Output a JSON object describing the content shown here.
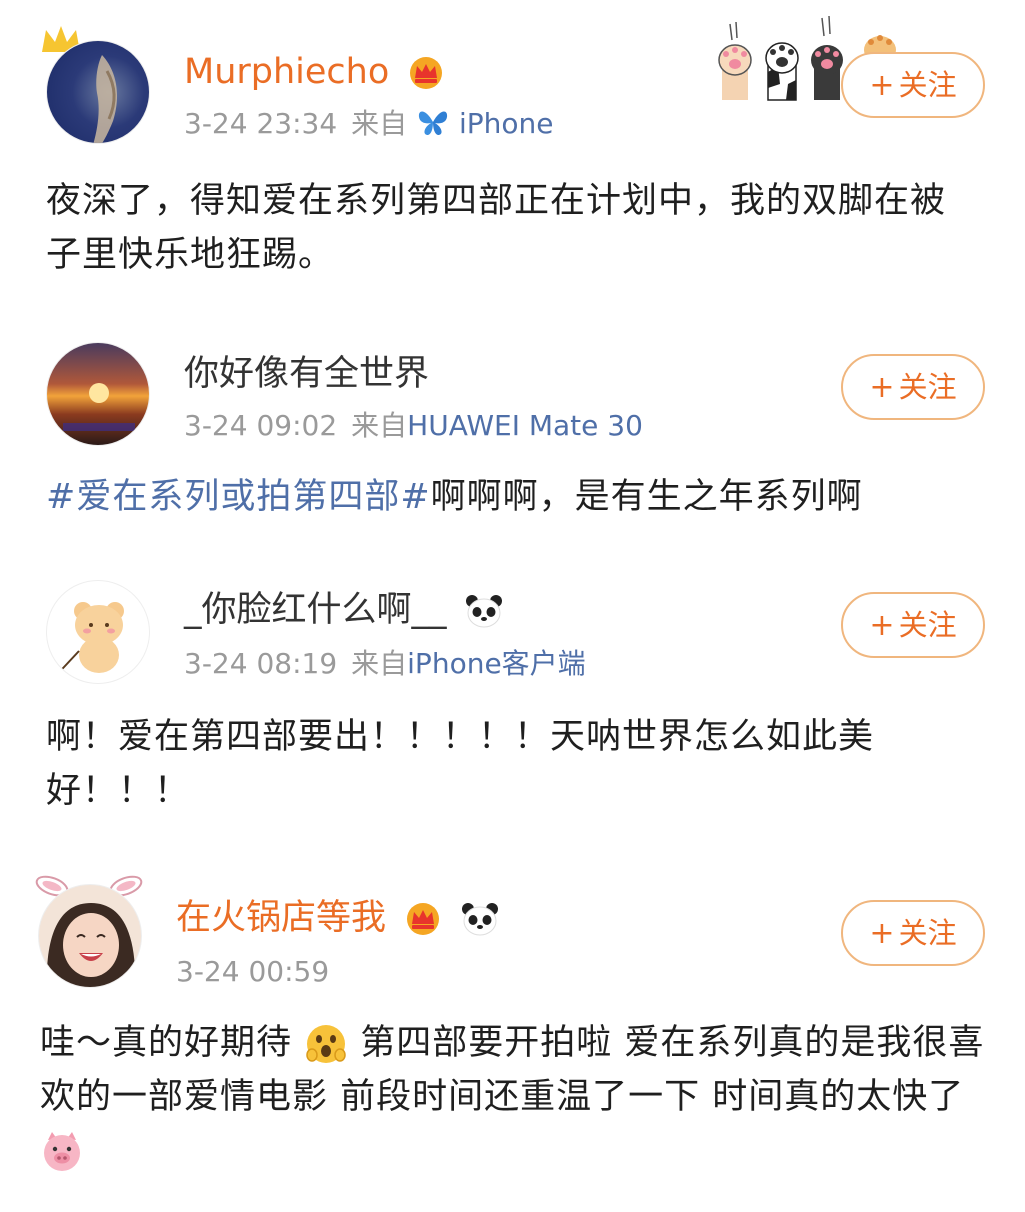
{
  "posts": [
    {
      "username": "Murphiecho",
      "time": "3-24 23:34",
      "source_prefix": "来自",
      "source": "iPhone",
      "follow_label": "关注",
      "content": "夜深了，得知爱在系列第四部正在计划中，我的双脚在被子里快乐地狂踢。"
    },
    {
      "username": "你好像有全世界",
      "time": "3-24 09:02",
      "source_prefix": "来自",
      "source": "HUAWEI Mate 30",
      "follow_label": "关注",
      "hashtag": "#爱在系列或拍第四部#",
      "content": "啊啊啊，是有生之年系列啊"
    },
    {
      "username": "_你脸红什么啊__",
      "time": "3-24 08:19",
      "source_prefix": "来自",
      "source": "iPhone客户端",
      "follow_label": "关注",
      "content": "啊！爱在第四部要出！！！！！天呐世界怎么如此美好！！！"
    },
    {
      "username": "在火锅店等我",
      "time": "3-24 00:59",
      "follow_label": "关注",
      "content_part1": "哇～真的好期待",
      "content_part2": "第四部要开拍啦 爱在系列真的是我很喜欢的一部爱情电影 前段时间还重温了一下 时间真的太快了"
    }
  ],
  "icons": {
    "vip_badge": "crown-badge-icon",
    "panda": "panda-icon",
    "butterfly": "butterfly-icon",
    "pig": "pig-icon",
    "shocked": "shocked-face-icon",
    "paws": "cat-paws-decoration"
  },
  "colors": {
    "vip_name": "#ea6d25",
    "link": "#4f6fa8",
    "meta": "#9a9a9a",
    "follow_border": "#f0b67e"
  }
}
